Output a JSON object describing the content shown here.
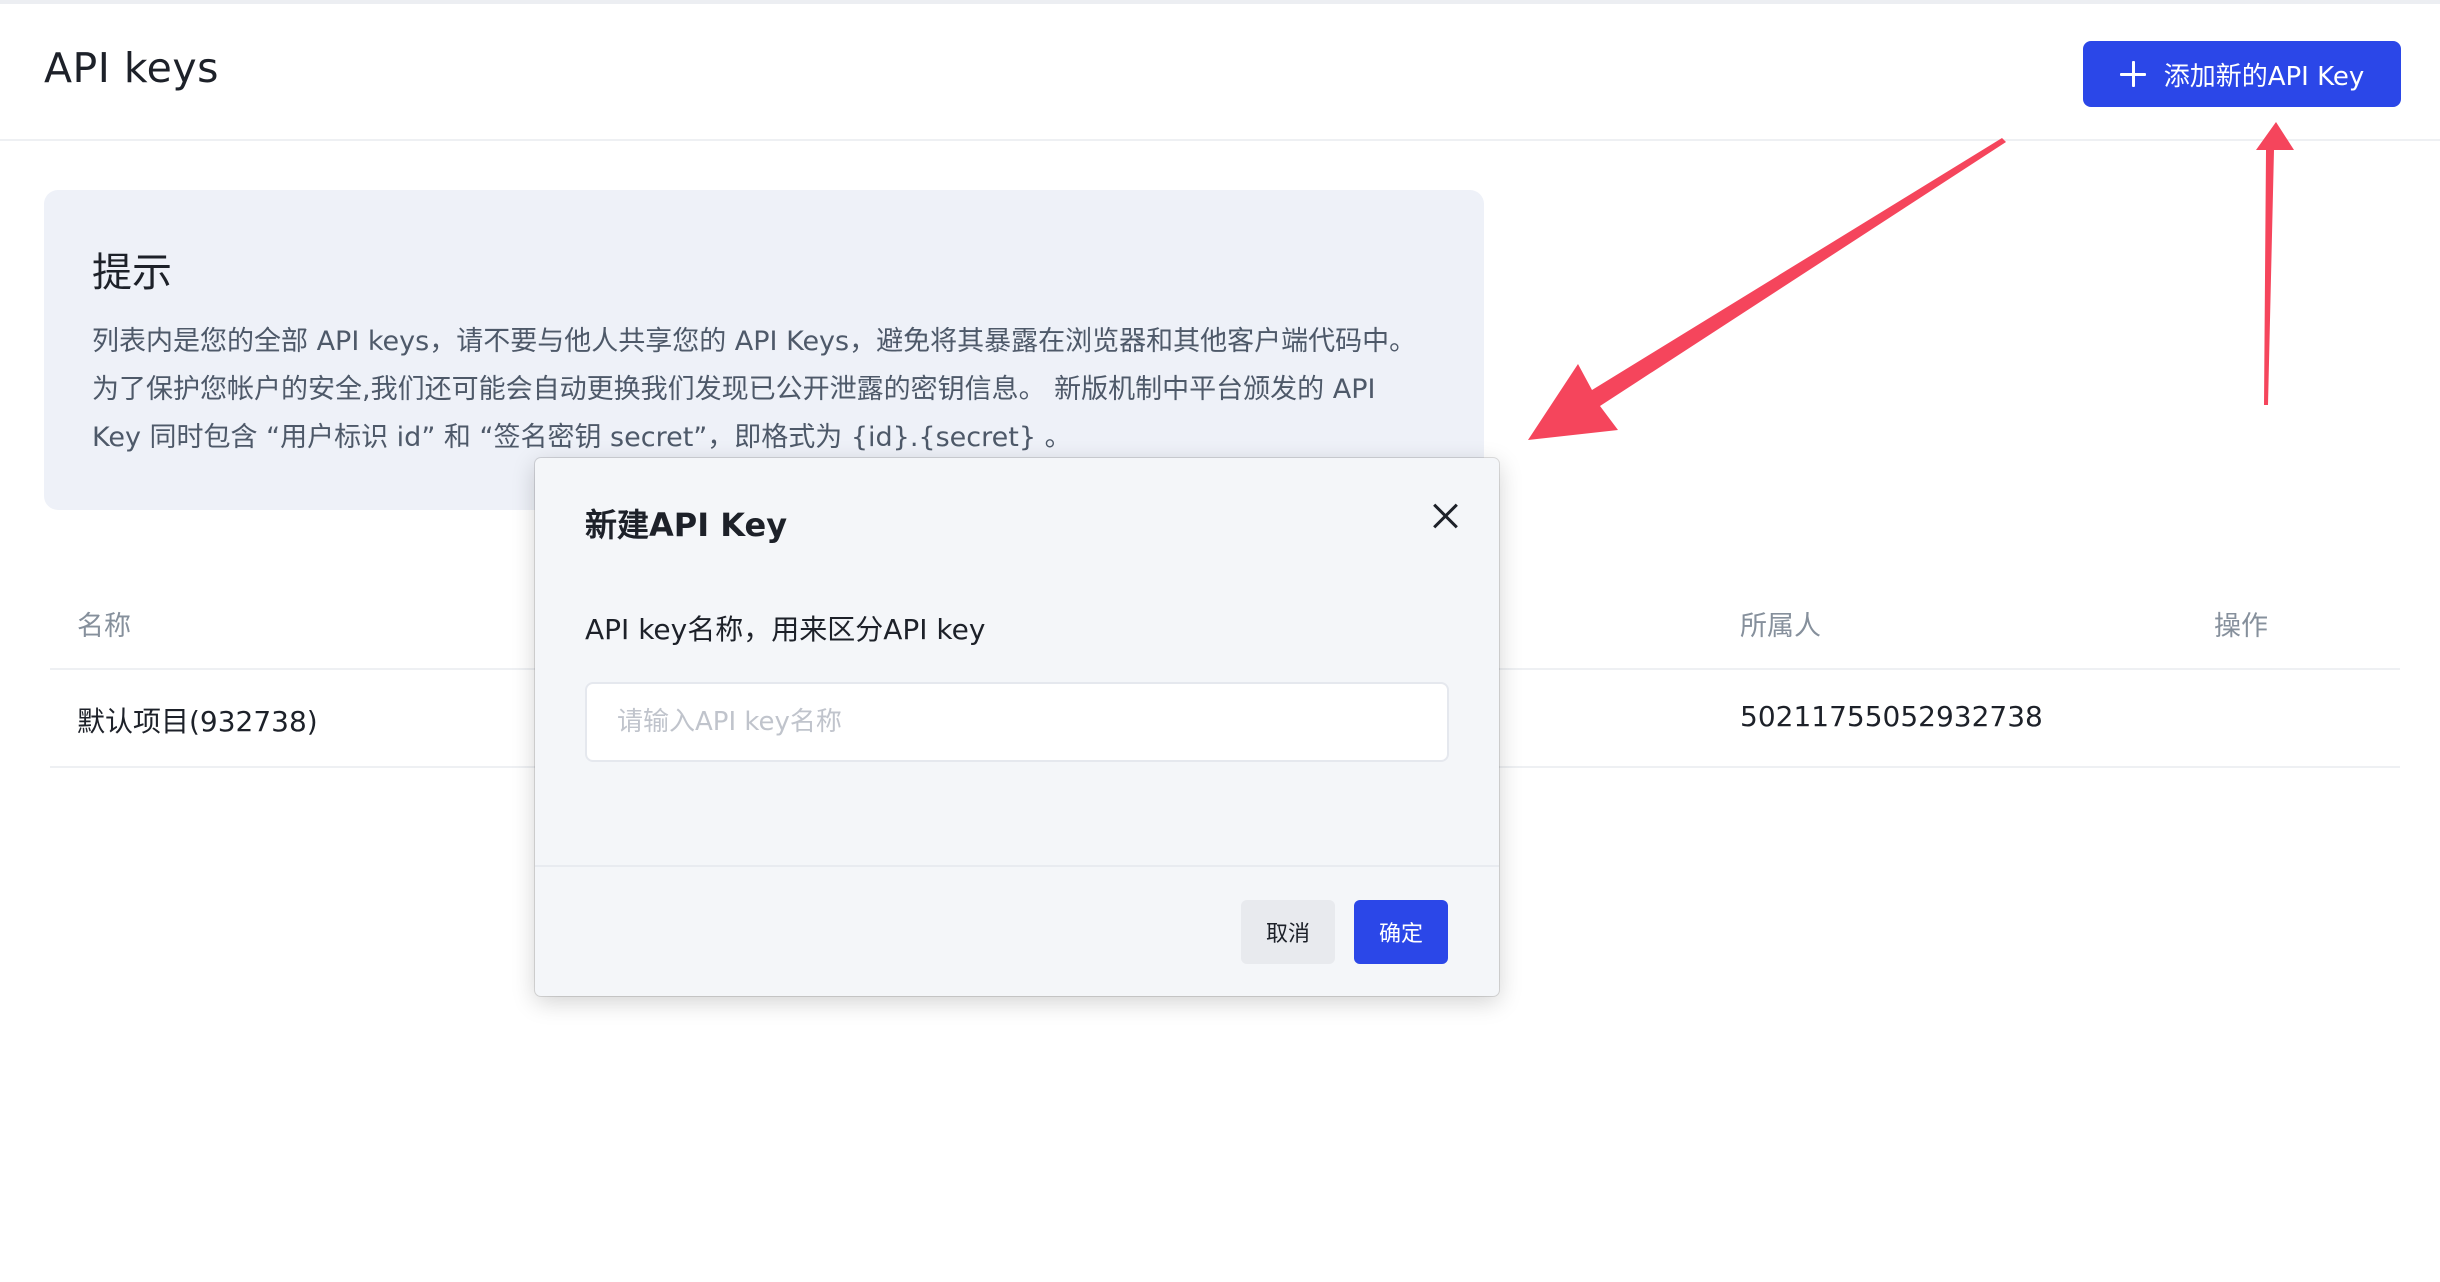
{
  "header": {
    "title": "API keys",
    "add_button_label": "添加新的API Key"
  },
  "tip": {
    "title": "提示",
    "text": "列表内是您的全部 API keys，请不要与他人共享您的 API Keys，避免将其暴露在浏览器和其他客户端代码中。为了保护您帐户的安全,我们还可能会自动更换我们发现已公开泄露的密钥信息。 新版机制中平台颁发的 API Key 同时包含 “用户标识 id” 和 “签名密钥 secret”，即格式为 {id}.{secret} 。"
  },
  "table": {
    "columns": [
      "名称",
      "所属人",
      "操作"
    ],
    "rows": [
      {
        "name": "默认项目(932738)",
        "owner": "50211755052932738"
      }
    ]
  },
  "modal": {
    "title": "新建API Key",
    "field_label": "API key名称，用来区分API key",
    "input_placeholder": "请输入API key名称",
    "input_value": "",
    "cancel_label": "取消",
    "ok_label": "确定"
  },
  "colors": {
    "primary": "#2b47e8",
    "annotation_arrow": "#f5455c"
  }
}
